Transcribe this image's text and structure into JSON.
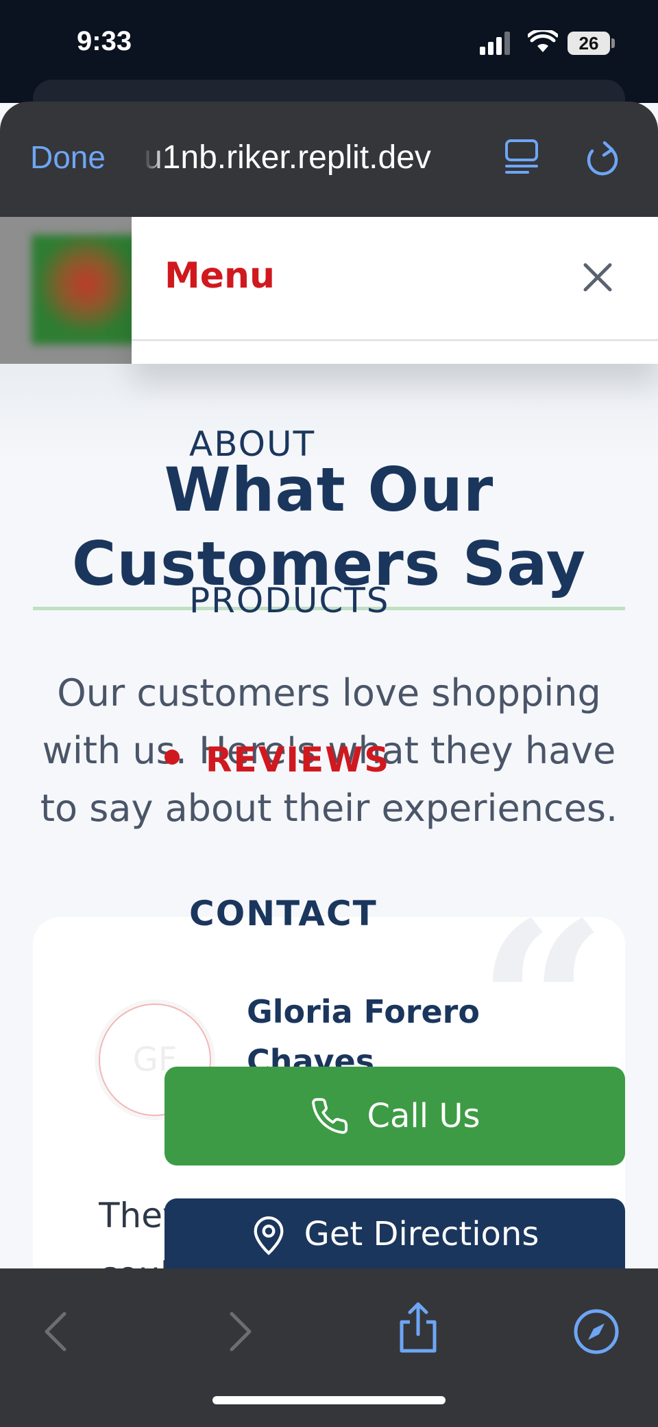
{
  "status_bar": {
    "time": "9:33",
    "battery": "26"
  },
  "browser": {
    "done_label": "Done",
    "url": "u1nb.riker.replit.dev"
  },
  "menu": {
    "title": "Menu",
    "items": [
      {
        "label": "ABOUT"
      },
      {
        "label": "PRODUCTS"
      },
      {
        "label": "REVIEWS",
        "active": true
      },
      {
        "label": "CONTACT"
      }
    ]
  },
  "reviews_section": {
    "title_line1": "What Our",
    "title_line2": "Customers Say",
    "description": "Our customers love shopping with us. Here's what they have to say about their experiences.",
    "card": {
      "initials": "GF",
      "name": "Gloria Forero Chaves",
      "text_line1": "They have fresh produce. I",
      "text_line2": "could"
    }
  },
  "actions": {
    "call_label": "Call Us",
    "directions_label": "Get Directions"
  },
  "colors": {
    "brand_red": "#d0191f",
    "navy": "#1b365d",
    "green": "#3d9b45",
    "accent_blue": "#6ea6f5"
  }
}
